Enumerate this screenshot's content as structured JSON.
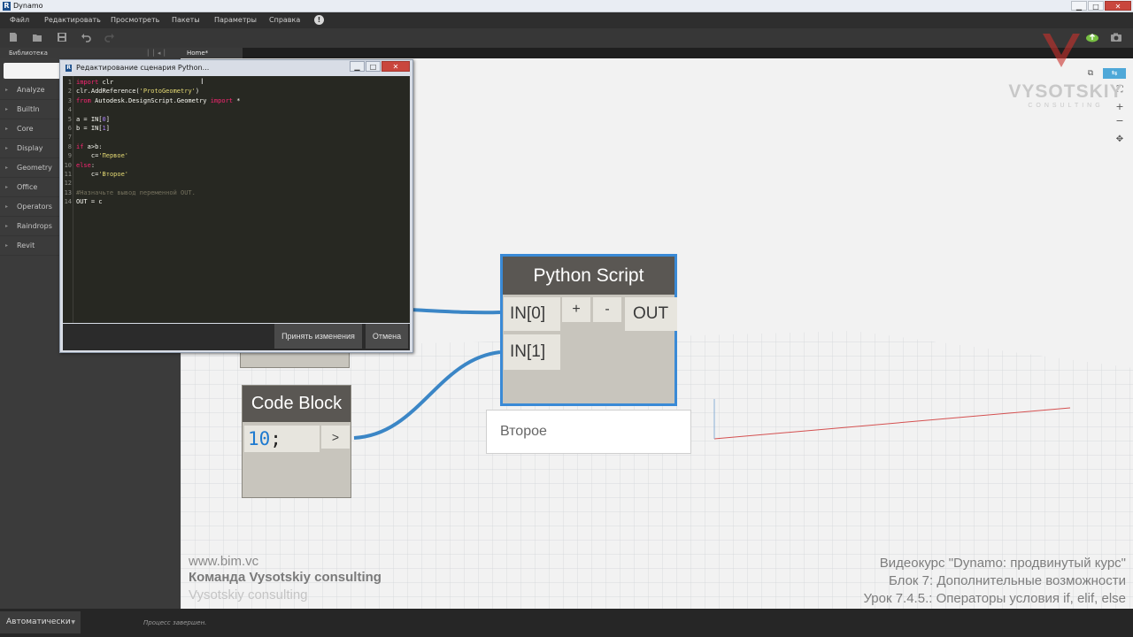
{
  "window": {
    "app_icon": "R",
    "title": "Dynamo",
    "minimize": "▁",
    "maximize": "□",
    "close": "✕"
  },
  "menu": [
    "Файл",
    "Редактировать",
    "Просмотреть",
    "Пакеты",
    "Параметры",
    "Справка",
    "!"
  ],
  "library": {
    "header": "Библиотека",
    "items": [
      "Analyze",
      "BuiltIn",
      "Core",
      "Display",
      "Geometry",
      "Office",
      "Operators",
      "Raindrops",
      "Revit"
    ]
  },
  "tab": {
    "label": "Home*"
  },
  "python_editor": {
    "icon": "R",
    "title": "Редактирование сценария Python...",
    "lines": [
      {
        "n": "1",
        "parts": [
          {
            "t": "import",
            "c": "kw"
          },
          {
            "t": " clr",
            "c": ""
          }
        ]
      },
      {
        "n": "2",
        "parts": [
          {
            "t": "clr.AddReference(",
            "c": ""
          },
          {
            "t": "'ProtoGeometry'",
            "c": "str"
          },
          {
            "t": ")",
            "c": ""
          }
        ]
      },
      {
        "n": "3",
        "parts": [
          {
            "t": "from",
            "c": "kw"
          },
          {
            "t": " Autodesk.DesignScript.Geometry ",
            "c": ""
          },
          {
            "t": "import",
            "c": "kw"
          },
          {
            "t": " *",
            "c": ""
          }
        ]
      },
      {
        "n": "4",
        "parts": []
      },
      {
        "n": "5",
        "parts": [
          {
            "t": "a = IN[",
            "c": ""
          },
          {
            "t": "0",
            "c": "num"
          },
          {
            "t": "]",
            "c": ""
          }
        ]
      },
      {
        "n": "6",
        "parts": [
          {
            "t": "b = IN[",
            "c": ""
          },
          {
            "t": "1",
            "c": "num"
          },
          {
            "t": "]",
            "c": ""
          }
        ]
      },
      {
        "n": "7",
        "parts": []
      },
      {
        "n": "8",
        "parts": [
          {
            "t": "if",
            "c": "kw"
          },
          {
            "t": " a>b:",
            "c": ""
          }
        ]
      },
      {
        "n": "9",
        "parts": [
          {
            "t": "    c=",
            "c": ""
          },
          {
            "t": "'Первое'",
            "c": "str"
          }
        ]
      },
      {
        "n": "10",
        "parts": [
          {
            "t": "else",
            "c": "kw"
          },
          {
            "t": ":",
            "c": ""
          }
        ]
      },
      {
        "n": "11",
        "parts": [
          {
            "t": "    c=",
            "c": ""
          },
          {
            "t": "'Второе'",
            "c": "str"
          }
        ]
      },
      {
        "n": "12",
        "parts": []
      },
      {
        "n": "13",
        "parts": [
          {
            "t": "#Назначьте вывод переменной OUT.",
            "c": "cmt"
          }
        ]
      },
      {
        "n": "14",
        "parts": [
          {
            "t": "OUT = c",
            "c": ""
          }
        ]
      }
    ],
    "accept_label": "Принять изменения",
    "cancel_label": "Отмена"
  },
  "python_node": {
    "title": "Python Script",
    "in0": "IN[0]",
    "in1": "IN[1]",
    "plus": "+",
    "minus": "-",
    "out": "OUT",
    "preview": "Второе"
  },
  "code_block": {
    "title": "Code Block",
    "code_num": "10",
    "code_semi": ";",
    "out": ">"
  },
  "logo": {
    "name": "VYSOTSKIY",
    "sub": "CONSULTING"
  },
  "watermark_left": {
    "line1": "www.bim.vc",
    "line2": "Команда Vysotskiy consulting",
    "line3": "Vysotskiy consulting"
  },
  "watermark_right": {
    "line1": "Видеокурс \"Dynamo: продвинутый курс\"",
    "line2": "Блок 7: Дополнительные возможности",
    "line3": "Урок 7.4.5.: Операторы условия if, elif, else"
  },
  "statusbar": {
    "run_mode": "Автоматически",
    "status": "Процесс завершен."
  },
  "colors": {
    "wire": "#3b86c6",
    "node_border_selected": "#3a8ad6",
    "node_header": "#5a5753",
    "editor_bg": "#272822"
  }
}
